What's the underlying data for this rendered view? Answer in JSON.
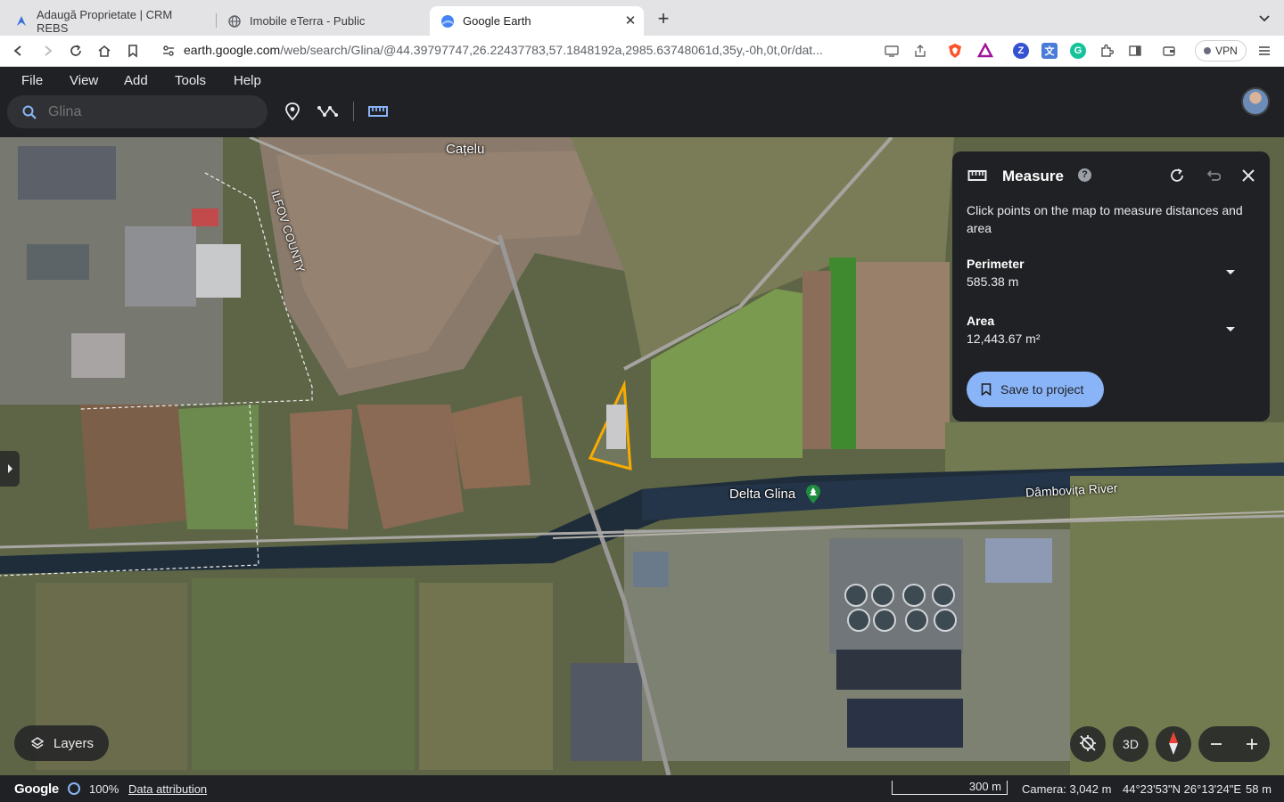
{
  "browser": {
    "tabs": [
      {
        "title": "Adaugă Proprietate | CRM REBS",
        "icon": "crm-favicon-icon"
      },
      {
        "title": "Imobile eTerra - Public",
        "icon": "globe-favicon-icon"
      },
      {
        "title": "Google Earth",
        "icon": "google-earth-favicon-icon",
        "active": true
      }
    ],
    "url_host": "earth.google.com",
    "url_rest": "/web/search/Glina/@44.39797747,26.22437783,57.1848192a,2985.63748061d,35y,-0h,0t,0r/dat...",
    "vpn_label": "VPN"
  },
  "app": {
    "menu": [
      "File",
      "View",
      "Add",
      "Tools",
      "Help"
    ],
    "search_placeholder": "Glina"
  },
  "map": {
    "labels": {
      "catelu": "Cațelu",
      "ilfov_county": "ILFOV COUNTY",
      "delta_glina": "Delta Glina",
      "dambovita": "Dâmbovița River"
    }
  },
  "measure": {
    "title": "Measure",
    "help": "?",
    "description": "Click points on the map to measure distances and area",
    "perimeter_label": "Perimeter",
    "perimeter_value": "585.38 m",
    "area_label": "Area",
    "area_value": "12,443.67 m²",
    "save_label": "Save to project"
  },
  "controls": {
    "layers_label": "Layers",
    "three_d_label": "3D"
  },
  "status": {
    "logo": "Google",
    "zoom_pct": "100%",
    "attribution": "Data attribution",
    "scale": "300 m",
    "camera": "Camera: 3,042 m",
    "coords": "44°23'53\"N 26°13'24\"E",
    "elevation": "58 m"
  },
  "colors": {
    "accent": "#8ab4f8",
    "panel_bg": "#202124",
    "polygon": "#f9ab00",
    "place_pin": "#1e8e3e"
  }
}
